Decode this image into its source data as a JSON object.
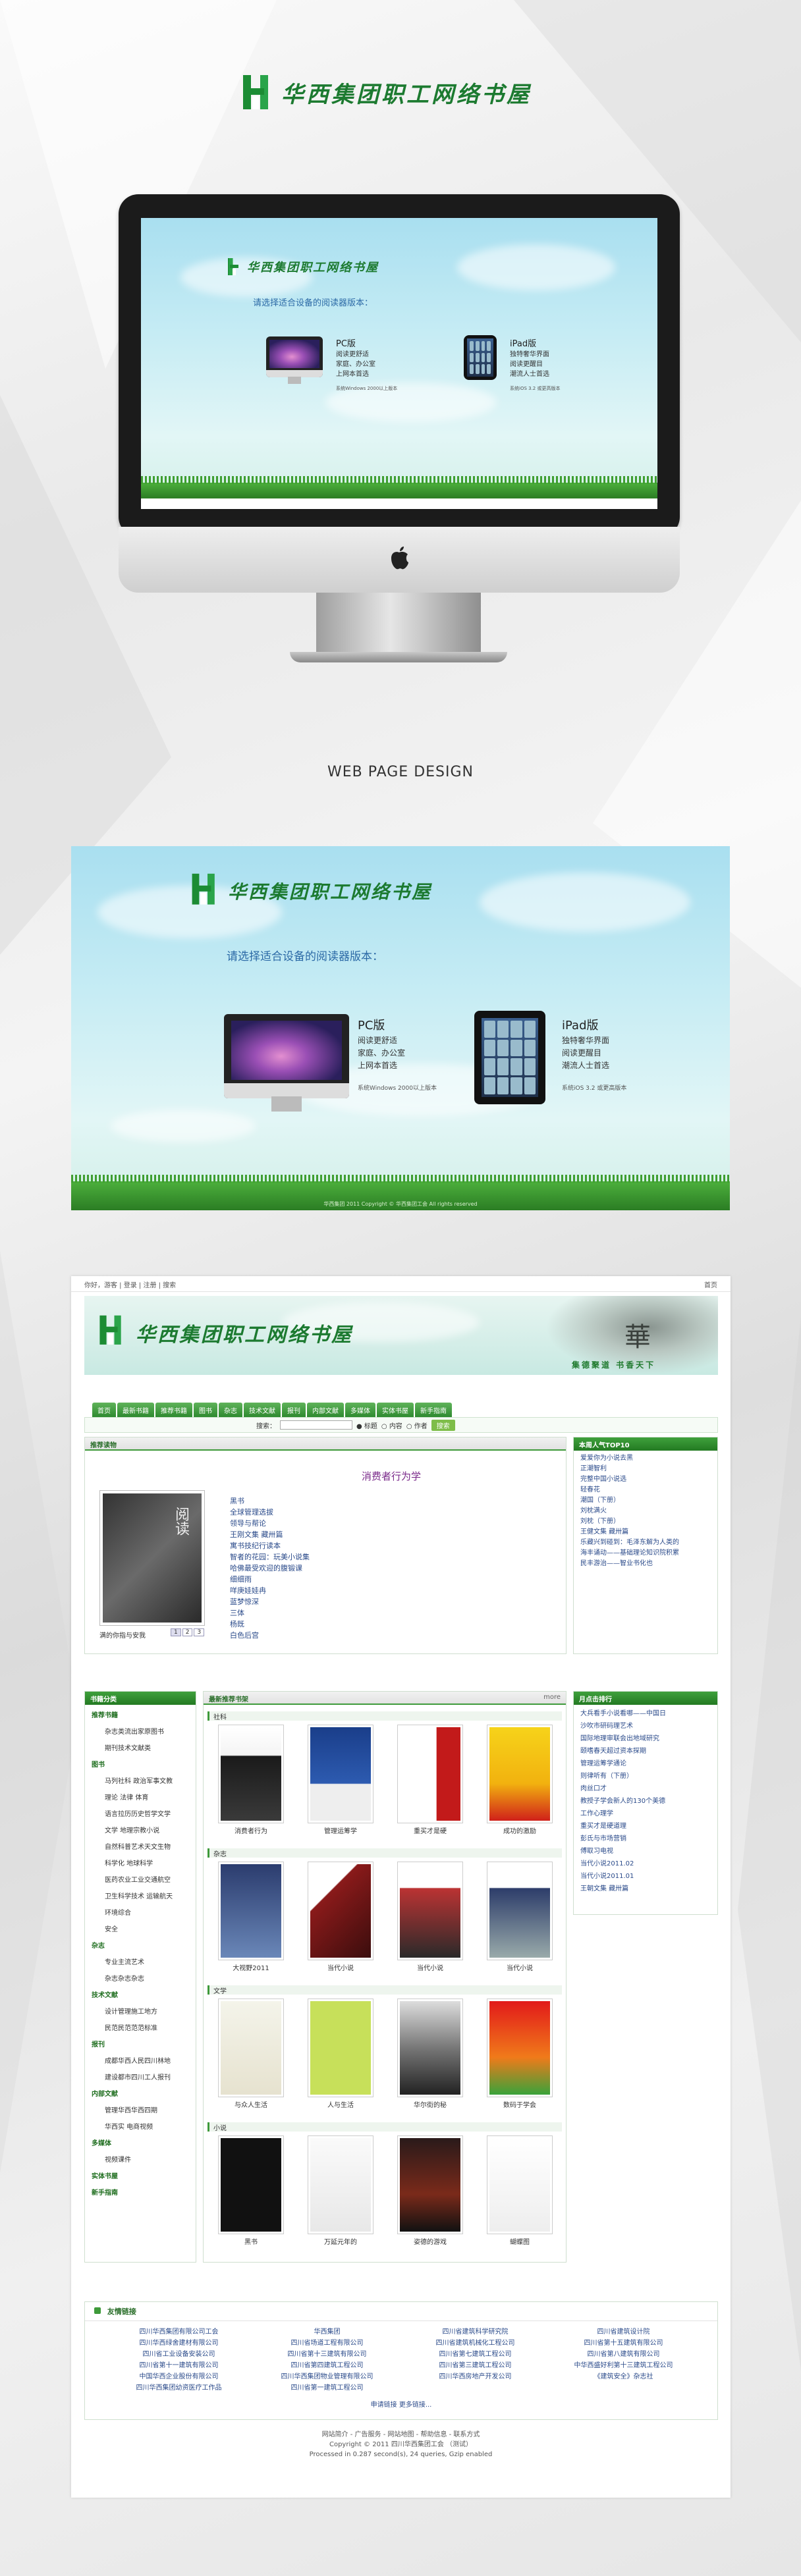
{
  "brand": {
    "title": "华西集团职工网络书屋"
  },
  "reader": {
    "prompt": "请选择适合设备的阅读器版本：",
    "pc": {
      "title": "PC版",
      "lines": [
        "阅读更舒适",
        "家庭、办公室",
        "上网本首选"
      ],
      "note": "系统Windows 2000以上版本"
    },
    "ipad": {
      "title": "iPad版",
      "lines": [
        "独特奢华界面",
        "阅读更醒目",
        "潮流人士首选"
      ],
      "note": "系统iOS 3.2 或更高版本"
    },
    "footnote": "华西集团 2011 Copyright © 华西集团工会 All rights reserved"
  },
  "caption": "WEB PAGE DESIGN",
  "site": {
    "topbar": {
      "left": "你好，游客 | 登录 | 注册 | 搜索",
      "right": "首页"
    },
    "slogan": "集德聚道 书香天下",
    "seal": "華",
    "nav": [
      "首页",
      "最新书籍",
      "推荐书籍",
      "图书",
      "杂志",
      "技术文献",
      "报刊",
      "内部文献",
      "多媒体",
      "实体书屋",
      "新手指南"
    ],
    "search": {
      "label": "搜索：",
      "options": [
        "标题",
        "内容",
        "作者"
      ],
      "button": "搜索"
    },
    "featured": {
      "header": "推荐读物",
      "book_title": "消费者行为学",
      "cover_caption": "满的你指与安我",
      "pages": [
        "1",
        "2",
        "3"
      ],
      "items": [
        "黑书",
        "全球管理选拔",
        "领导与帮论",
        "王刚文集 藏卅篇",
        "寓书技纪行读本",
        "智者的花园：玩美小说集",
        "哈佛最受欢迎的腹锻课",
        "细细雨",
        "咩庚娃娃冉",
        "蓝梦惊深",
        "三体",
        "杨既",
        "白色后宫"
      ]
    },
    "top10": {
      "header": "本周人气TOP10",
      "items": [
        "爱爱你为小说去黑",
        "正潮智利",
        "完整中国小说选",
        "轻春花",
        "潮国（下册）",
        "刘枕满火",
        "刘枕（下册）",
        "王健文集 藏卅篇",
        "乐藏兴到碰到：毛泽东解为人类的",
        "海丰诵动——基础理论知识院积累",
        "民丰游治——智业书化也"
      ]
    },
    "categories": {
      "header": "书籍分类",
      "groups": [
        {
          "title": "推荐书籍",
          "items": [
            "杂志类流出家原图书",
            "期刊技术文献类"
          ]
        },
        {
          "title": "图书",
          "items": [
            "马列社科 政治军事文教",
            "理论 法律 体育",
            "语言拉历历史哲学文学",
            "文学 地理宗教小说",
            "自然科普艺术天文生物",
            "科学化 地球科学",
            "医药农业工业交通航空",
            "卫生科学技术 运输航天",
            "环境综合",
            "安全"
          ]
        },
        {
          "title": "杂志",
          "items": [
            "专业主流艺术",
            "杂志杂志杂志"
          ]
        },
        {
          "title": "技术文献",
          "items": [
            "设计管理施工地方",
            "民范民范范范标准"
          ]
        },
        {
          "title": "报刊",
          "items": [
            "成都华西人民四川林地",
            "建设都市四川工人报刊"
          ]
        },
        {
          "title": "内部文献",
          "items": [
            "管理华西华西四期",
            "华西实 电商视频"
          ]
        },
        {
          "title": "多媒体",
          "items": [
            "视频课件"
          ]
        },
        {
          "title": "实体书屋",
          "items": []
        },
        {
          "title": "新手指南",
          "items": []
        }
      ]
    },
    "newbooks": {
      "header": "最新推荐书架",
      "more": "more",
      "sections": [
        {
          "name": "社科",
          "books": [
            "消费者行为",
            "管理运筹学",
            "重买才是硬",
            "成功的激励"
          ]
        },
        {
          "name": "杂志",
          "books": [
            "大视野2011",
            "当代小说",
            "当代小说",
            "当代小说"
          ]
        },
        {
          "name": "文学",
          "books": [
            "与众人生活",
            "人与生活",
            "华尔街的秘",
            "数码于学会"
          ]
        },
        {
          "name": "小说",
          "books": [
            "黑书",
            "万延元年的",
            "姿德的游戏",
            "蝴蝶图"
          ]
        }
      ]
    },
    "monthly": {
      "header": "月点击排行",
      "items": [
        "大兵看手小说看哪——中国日",
        "沙吹市研码理艺术",
        "国际地理审联会出地域研究",
        "颐嗜春天超过资本探期",
        "管理运筹学通论",
        "则律听有（下册）",
        "肉丝口才",
        "教授子学会新人的130个美德",
        "工作心理学",
        "重买才是硬道理",
        "彭氏与市场营销",
        "傅取习电视",
        "当代小说2011.02",
        "当代小说2011.01",
        "王朝文集 藏卅篇"
      ]
    },
    "friendlinks": {
      "header": "友情链接",
      "items": [
        "四川华西集团有限公司工会",
        "华西集团",
        "四川省建筑科学研究院",
        "四川省建筑设计院",
        "四川华西绿舍建材有限公司",
        "四川省场道工程有限公司",
        "四川省建筑机械化工程公司",
        "四川省第十五建筑有限公司",
        "四川省工业设备安装公司",
        "四川省第十三建筑有限公司",
        "四川省第七建筑工程公司",
        "四川省第八建筑有限公司",
        "四川省第十一建筑有限公司",
        "四川省第四建筑工程公司",
        "四川省第三建筑工程公司",
        "中华西盛好利第十三建筑工程公司",
        "中国华西企业股份有限公司",
        "四川华西集团物业管理有限公司",
        "四川华西房地产开发公司",
        "《建筑安全》杂志社",
        "四川华西集团幼资医疗工作品",
        "四川省第一建筑工程公司"
      ],
      "more": "申请链接 更多链接..."
    },
    "footer": [
      "网站简介 - 广告服务 - 网站地图 - 帮助信息 - 联系方式",
      "Copyright © 2011 四川华西集团工会 （测试）",
      "Processed in 0.287 second(s), 24 queries, Gzip enabled"
    ]
  }
}
